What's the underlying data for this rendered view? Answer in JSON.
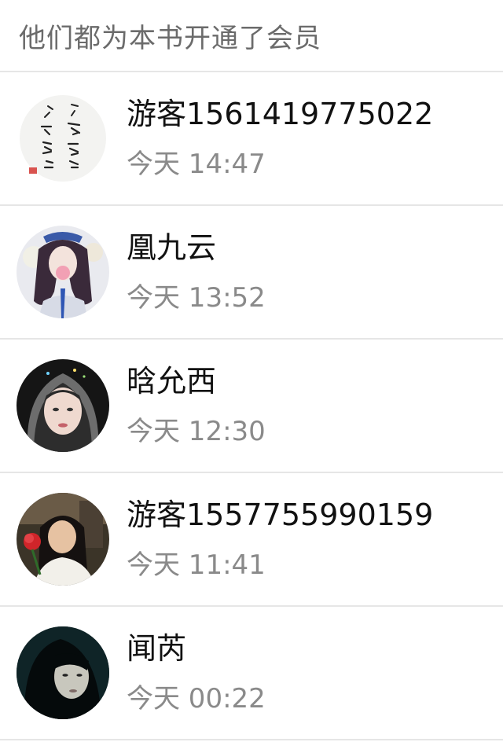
{
  "header": {
    "title": "他们都为本书开通了会员"
  },
  "members": [
    {
      "name": "游客1561419775022",
      "time": "今天 14:47",
      "avatar_icon": "calligraphy-avatar-icon"
    },
    {
      "name": "凰九云",
      "time": "今天 13:52",
      "avatar_icon": "anime-girl-avatar-icon"
    },
    {
      "name": "晗允西",
      "time": "今天 12:30",
      "avatar_icon": "hooded-portrait-avatar-icon"
    },
    {
      "name": "游客1557755990159",
      "time": "今天 11:41",
      "avatar_icon": "girl-with-rose-avatar-icon"
    },
    {
      "name": "闻芮",
      "time": "今天 00:22",
      "avatar_icon": "dark-portrait-avatar-icon"
    }
  ],
  "colors": {
    "divider": "#e6e6e6",
    "title_text": "#6b6b6b",
    "name_text": "#111111",
    "time_text": "#8a8a8a"
  }
}
